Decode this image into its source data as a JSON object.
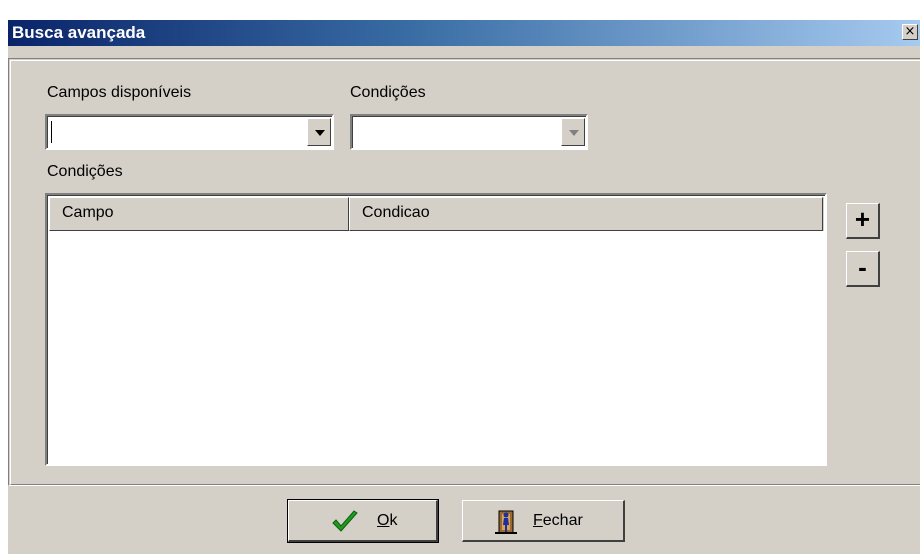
{
  "window": {
    "title": "Busca avançada",
    "close_glyph": "×"
  },
  "fields": {
    "available_label": "Campos disponíveis",
    "available_value": "",
    "conditions_label": "Condições",
    "conditions_value": ""
  },
  "list": {
    "label": "Condições",
    "columns": [
      "Campo",
      "Condicao"
    ],
    "rows": []
  },
  "side_buttons": {
    "add": "+",
    "remove": "-"
  },
  "buttons": {
    "ok_accel": "O",
    "ok_rest": "k",
    "close_accel": "F",
    "close_rest": "echar"
  },
  "icons": {
    "ok": "checkmark-icon",
    "close": "door-exit-icon"
  },
  "colors": {
    "title_start": "#0a246a",
    "title_end": "#a6caf0",
    "face": "#d4d0c8",
    "check": "#1f9b1f"
  }
}
